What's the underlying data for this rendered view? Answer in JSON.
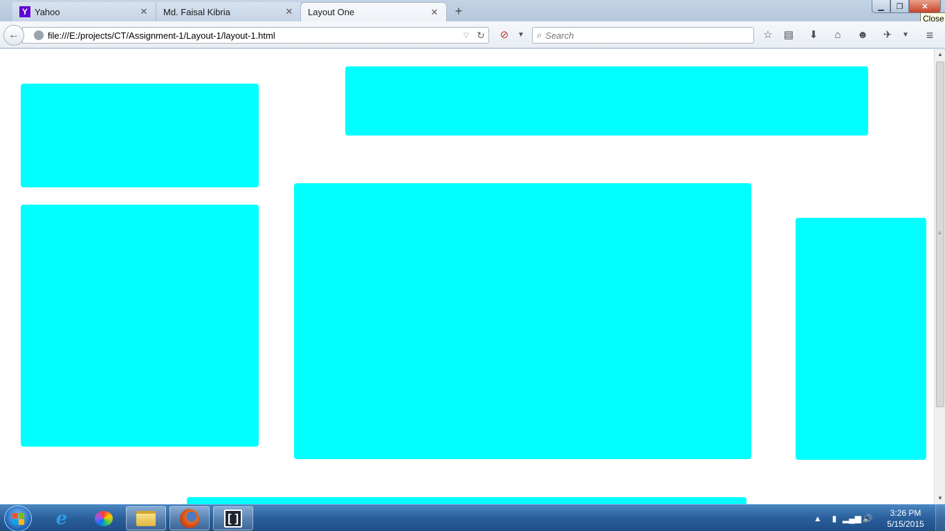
{
  "browser": {
    "tabs": [
      {
        "title": "Yahoo",
        "favicon": "yahoo-icon",
        "active": false
      },
      {
        "title": "Md. Faisal Kibria",
        "favicon": "",
        "active": false
      },
      {
        "title": "Layout One",
        "favicon": "",
        "active": true
      }
    ],
    "close_tooltip": "Close",
    "url": "file:///E:/projects/CT/Assignment-1/Layout-1/layout-1.html",
    "search_placeholder": "Search",
    "toolbar_icons": [
      "bookmark-star-icon",
      "reading-list-icon",
      "download-icon",
      "home-icon",
      "chat-icon",
      "extension-icon",
      "menu-icon"
    ]
  },
  "page": {
    "background": "#ffffff",
    "box_color": "#00ffff",
    "boxes": [
      "top-left-box",
      "top-banner-box",
      "left-tall-box",
      "main-center-box",
      "right-side-box",
      "bottom-box"
    ]
  },
  "taskbar": {
    "apps": [
      "internet-explorer-icon",
      "paint-icon",
      "file-explorer-icon",
      "firefox-icon",
      "brackets-icon"
    ],
    "clock_time": "3:26 PM",
    "clock_date": "5/15/2015"
  },
  "colors": {
    "accent_cyan": "#00ffff",
    "taskbar_blue": "#2a5f9a",
    "close_red": "#c7432a"
  }
}
